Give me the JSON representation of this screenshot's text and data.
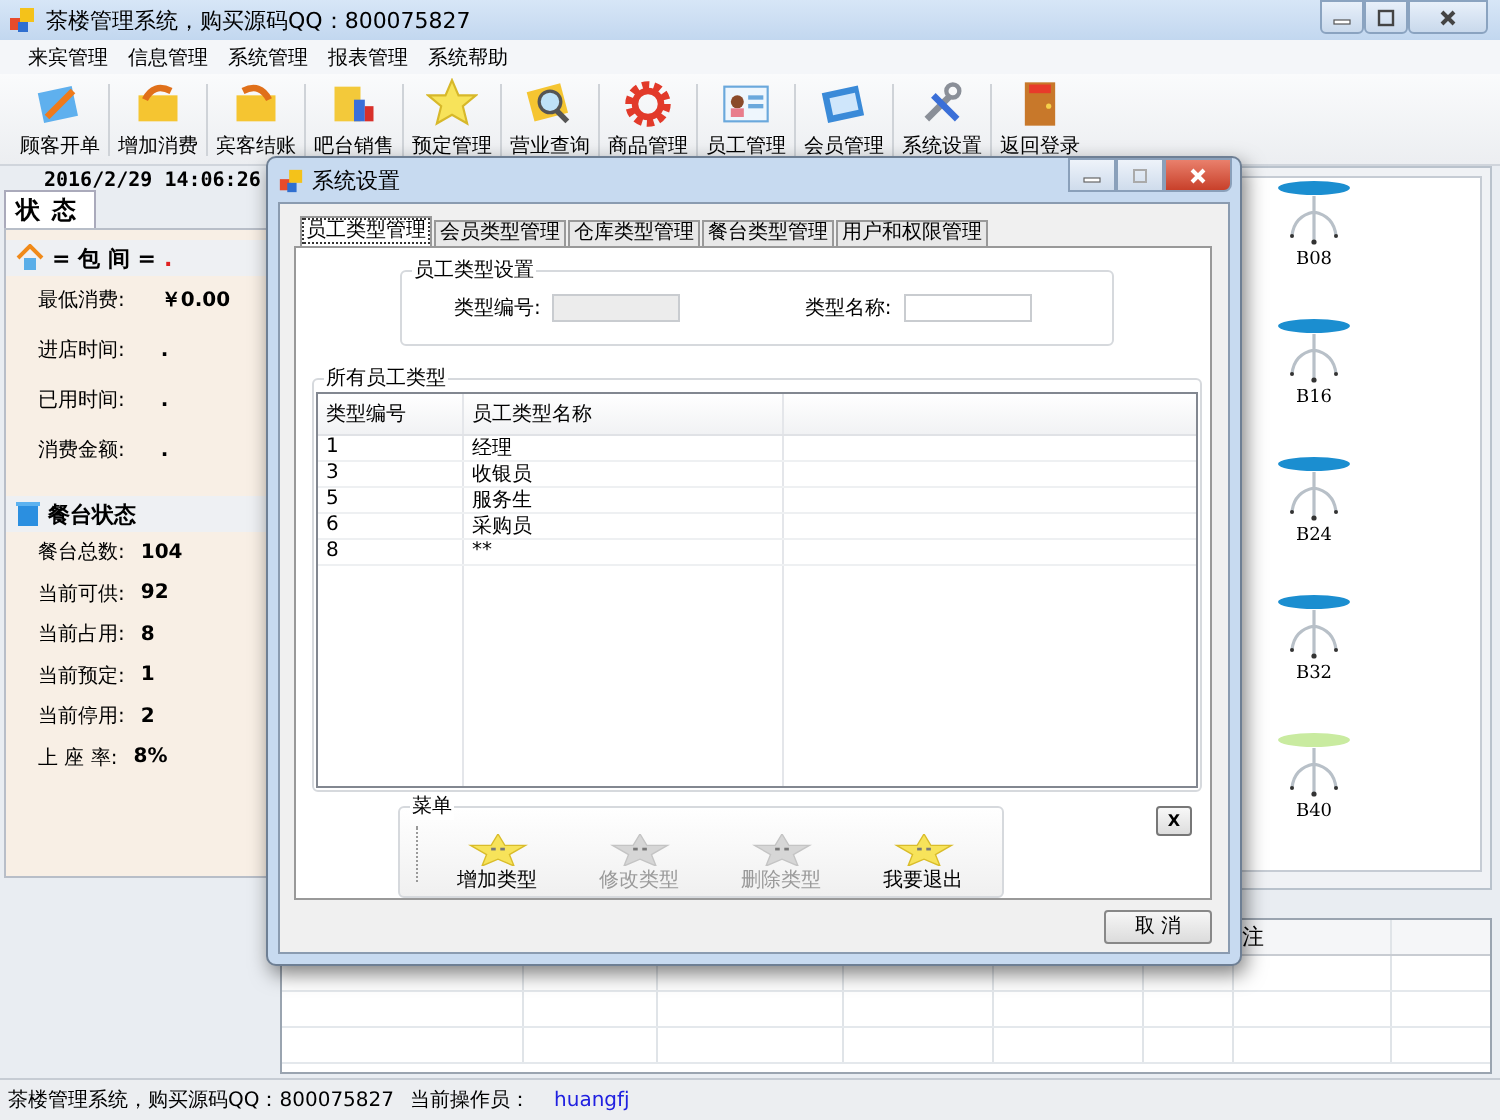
{
  "window": {
    "title": "茶楼管理系统，购买源码QQ：800075827"
  },
  "menu": [
    "来宾管理",
    "信息管理",
    "系统管理",
    "报表管理",
    "系统帮助"
  ],
  "toolbar": [
    {
      "label": "顾客开单"
    },
    {
      "label": "增加消费"
    },
    {
      "label": "宾客结账"
    },
    {
      "label": "吧台销售"
    },
    {
      "label": "预定管理"
    },
    {
      "label": "营业查询"
    },
    {
      "label": "商品管理"
    },
    {
      "label": "员工管理"
    },
    {
      "label": "会员管理"
    },
    {
      "label": "系统设置"
    },
    {
      "label": "返回登录"
    }
  ],
  "datetime": "2016/2/29 14:06:26",
  "status_panel": {
    "tab": "状 态",
    "room": {
      "title": "= 包 间 =",
      "name": ".",
      "fields": [
        {
          "label": "最低消费:",
          "value": "￥0.00"
        },
        {
          "label": "进店时间:",
          "value": "."
        },
        {
          "label": "已用时间:",
          "value": "."
        },
        {
          "label": "消费金额:",
          "value": "."
        }
      ]
    },
    "tables": {
      "title": "餐台状态",
      "fields": [
        {
          "label": "餐台总数:",
          "value": "104"
        },
        {
          "label": "当前可供:",
          "value": "92"
        },
        {
          "label": "当前占用:",
          "value": "8"
        },
        {
          "label": "当前预定:",
          "value": "1"
        },
        {
          "label": "当前停用:",
          "value": "2"
        },
        {
          "label": "上 座 率:",
          "value": "8%"
        }
      ]
    }
  },
  "table_map": [
    {
      "name": "B08",
      "color": "#1b8ed0"
    },
    {
      "name": "B16",
      "color": "#1b8ed0"
    },
    {
      "name": "B24",
      "color": "#1b8ed0"
    },
    {
      "name": "B32",
      "color": "#1b8ed0"
    },
    {
      "name": "B40",
      "color": "#c9eba0"
    }
  ],
  "bottom_grid": {
    "column_7": "注"
  },
  "status_bar": {
    "text": "茶楼管理系统，购买源码QQ：800075827",
    "operator_label": "当前操作员：",
    "operator": "huangfj"
  },
  "dialog": {
    "title": "系统设置",
    "tabs": [
      {
        "label": "员工类型管理",
        "selected": true
      },
      {
        "label": "会员类型管理",
        "selected": false
      },
      {
        "label": "仓库类型管理",
        "selected": false
      },
      {
        "label": "餐台类型管理",
        "selected": false
      },
      {
        "label": "用户和权限管理",
        "selected": false
      }
    ],
    "settings_group": {
      "title": "员工类型设置",
      "fields": [
        {
          "label": "类型编号:",
          "disabled": true
        },
        {
          "label": "类型名称:",
          "disabled": false
        }
      ]
    },
    "list_group": {
      "title": "所有员工类型",
      "columns": [
        "类型编号",
        "员工类型名称"
      ],
      "rows": [
        [
          "1",
          "经理"
        ],
        [
          "3",
          "收银员"
        ],
        [
          "5",
          "服务生"
        ],
        [
          "6",
          "采购员"
        ],
        [
          "8",
          "**"
        ]
      ]
    },
    "menu_group": {
      "title": "菜单",
      "buttons": [
        {
          "label": "增加类型",
          "disabled": false
        },
        {
          "label": "修改类型",
          "disabled": true
        },
        {
          "label": "删除类型",
          "disabled": true
        },
        {
          "label": "我要退出",
          "disabled": false
        }
      ]
    },
    "small_button": "X",
    "cancel_button": "取 消"
  }
}
